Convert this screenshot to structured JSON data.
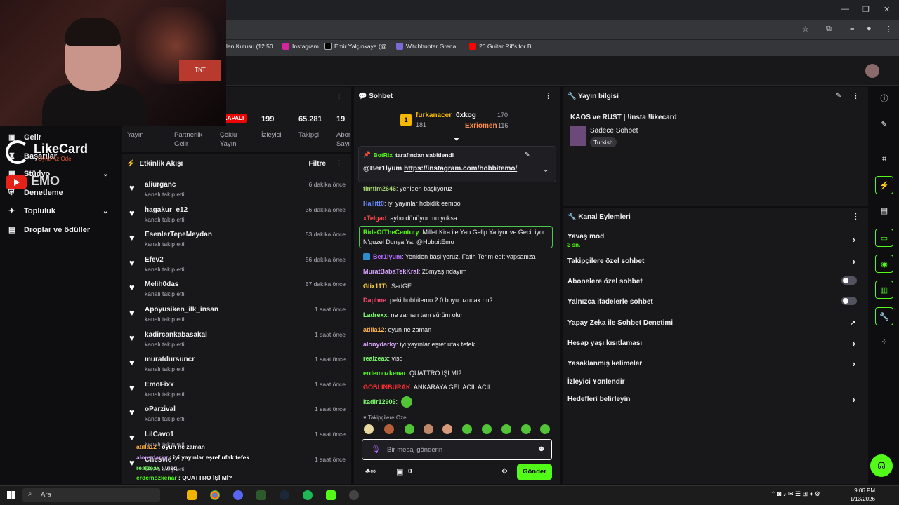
{
  "browser": {
    "bookmarks": [
      "len Kutusu (12.50...",
      "Instagram",
      "Emir Yalçınkaya (@...",
      "Witchhunter Grena...",
      "20 Guitar Riffs for B..."
    ]
  },
  "overlay": {
    "likecard_big": "LikeCard",
    "likecard_small": "Oyna Az Öde",
    "emo": "EMO"
  },
  "leftnav": {
    "items": [
      {
        "label": "Gelir",
        "icon": "dollar-icon"
      },
      {
        "label": "Başarılar",
        "icon": "trophy-icon"
      },
      {
        "label": "Stüdyo",
        "icon": "studio-icon"
      },
      {
        "label": "Denetleme",
        "icon": "shield-icon"
      },
      {
        "label": "Topluluk",
        "icon": "people-icon"
      },
      {
        "label": "Droplar ve ödüller",
        "icon": "gift-icon"
      }
    ]
  },
  "stats": {
    "offline_badge": "KAPALI",
    "values": [
      "199",
      "65.281",
      "19"
    ],
    "labels": [
      "Yayın",
      "Partnerlik Gelir",
      "Çoklu Yayın",
      "İzleyici",
      "Takipçi",
      "Abone Sayısı"
    ]
  },
  "feed": {
    "title": "Etkinlik Akışı",
    "filter_label": "Filtre",
    "items": [
      {
        "name": "aliurganc",
        "action": "kanalı takip etti",
        "time": "6 dakika önce"
      },
      {
        "name": "hagakur_e12",
        "action": "kanalı takip etti",
        "time": "36 dakika önce"
      },
      {
        "name": "EsenlerTepeMeydan",
        "action": "kanalı takip etti",
        "time": "53 dakika önce"
      },
      {
        "name": "Efev2",
        "action": "kanalı takip etti",
        "time": "56 dakika önce"
      },
      {
        "name": "Melih0das",
        "action": "kanalı takip etti",
        "time": "57 dakika önce"
      },
      {
        "name": "Apoyusiken_ilk_insan",
        "action": "kanalı takip etti",
        "time": "1 saat önce"
      },
      {
        "name": "kadircankabasakal",
        "action": "kanalı takip etti",
        "time": "1 saat önce"
      },
      {
        "name": "muratdursuncr",
        "action": "kanalı takip etti",
        "time": "1 saat önce"
      },
      {
        "name": "EmoFixx",
        "action": "kanalı takip etti",
        "time": "1 saat önce"
      },
      {
        "name": "oParzival",
        "action": "kanalı takip etti",
        "time": "1 saat önce"
      },
      {
        "name": "LilCavo1",
        "action": "kanalı takip etti",
        "time": "1 saat önce"
      },
      {
        "name": "Chesvie",
        "action": "kanalı takip etti",
        "time": "1 saat önce"
      }
    ]
  },
  "stream_overlay": [
    {
      "user": "atilla12",
      "text": "oyun ne zaman"
    },
    {
      "user": "alonydarky",
      "text": "iyi yayınlar eşref ufak tefek"
    },
    {
      "user": "realzeax",
      "text": "visq"
    },
    {
      "user": "erdemozkenar",
      "text": "QUATTRO İŞİ Mİ?"
    },
    {
      "user": "GOBLINBURAK",
      "text": "ANKARAYA GEL ACİL ACİL"
    },
    {
      "user": "kadir12906",
      "text": ""
    }
  ],
  "chat": {
    "title": "Sohbet",
    "top_gifters": [
      {
        "rank": "1",
        "name": "furkanacer",
        "count": "181"
      },
      {
        "name": "0xkog",
        "count": "170"
      },
      {
        "name": "Exriomen",
        "count": "116"
      }
    ],
    "pinned_by": "BotRix",
    "pinned_suffix": "tarafından sabitlendi",
    "pinned_user": "@Ber1lyum",
    "pinned_link": "https://instagram.com/hobbitemo/",
    "messages": [
      {
        "user": "timtim2646",
        "text": "yeniden başlıyoruz",
        "color": "#a7d673"
      },
      {
        "user": "Hallitt0",
        "text": "iyi yayınlar hobidik eemoo",
        "color": "#6a8cff"
      },
      {
        "user": "xTelgad",
        "text": "aybo dönüyor mu yoksa",
        "color": "#ff4b4b"
      },
      {
        "user": "RideOfTheCentury",
        "text": "Millet Kira ile Yan Gelip Yatiyor ve Geciniyor.",
        "color": "#53fc18"
      },
      {
        "user": "",
        "text": "N'guzel Dunya Ya. @HobbitEmo",
        "color": "#efeff1"
      },
      {
        "user": "Ber1lyum",
        "text": "Yeniden başlıyoruz. Fatih Terim edit yapsanıza",
        "color": "#b36bff"
      },
      {
        "user": "MuratBabaTekKral",
        "text": "25myaşındayım",
        "color": "#d8a4ff"
      },
      {
        "user": "Glix11Tr",
        "text": "SadGE",
        "color": "#ffd23c"
      },
      {
        "user": "Daphne",
        "text": "peki hobbitemo 2.0 boyu uzucak mı?",
        "color": "#ff4b6e"
      },
      {
        "user": "Ladrexx",
        "text": "ne zaman tam sürüm olur",
        "color": "#7cff6b"
      },
      {
        "user": "atilla12",
        "text": "oyun ne zaman",
        "color": "#ffb347"
      },
      {
        "user": "alonydarky",
        "text": "iyi yayınlar eşref ufak tefek",
        "color": "#d8a4ff"
      },
      {
        "user": "realzeax",
        "text": "visq",
        "color": "#7cff6b"
      },
      {
        "user": "erdemozkenar",
        "text": "QUATTRO İŞİ Mİ?",
        "color": "#53fc18"
      },
      {
        "user": "GOBLINBURAK",
        "text": "ANKARAYA GEL ACİL ACİL",
        "color": "#ff2e2e"
      },
      {
        "user": "kadir12906",
        "text": "",
        "color": "#7cff6b"
      }
    ],
    "followers_only_label": "Takipçilere Özel",
    "input_placeholder": "Bir mesaj gönderin",
    "points": "0",
    "send_label": "Gönder"
  },
  "info": {
    "title": "Yayın bilgisi",
    "stream_title": "KAOS ve RUST | !insta !likecard",
    "category": "Sadece Sohbet",
    "language": "Turkish"
  },
  "actions": {
    "title": "Kanal Eylemleri",
    "slow_mode": "Yavaş mod",
    "slow_mode_value": "3 sn.",
    "rows": [
      "Takipçilere özel sohbet",
      "Abonelere özel sohbet",
      "Yalnızca ifadelerle sohbet",
      "Yapay Zeka ile Sohbet Denetimi",
      "Hesap yaşı kısıtlaması",
      "Yasaklanmış kelimeler",
      "İzleyici Yönlendir",
      "Hedefleri belirleyin"
    ]
  },
  "taskbar": {
    "search": "Ara",
    "time": "9:06 PM",
    "date": "1/13/2026"
  },
  "colors": {
    "accent": "#53fc18",
    "panel": "#18181b",
    "bg": "#0e0e10"
  }
}
